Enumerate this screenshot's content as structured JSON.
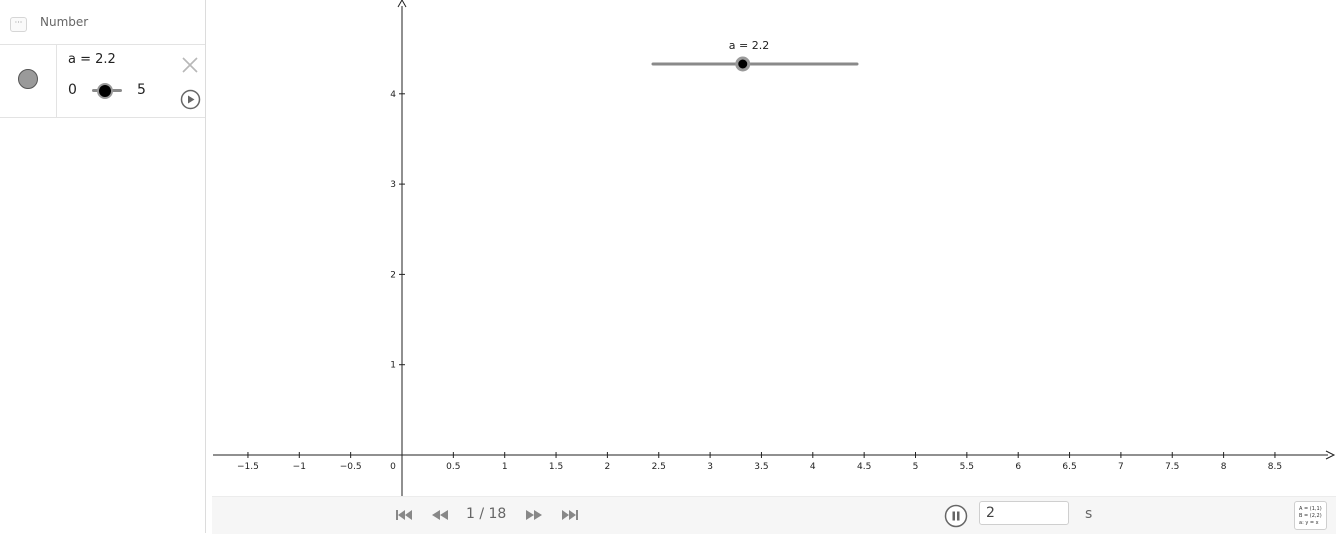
{
  "algebra": {
    "header_label": "Number",
    "collapse_label": "···",
    "item": {
      "definition": "a = 2.2",
      "slider_min": "0",
      "slider_max": "5",
      "marker_color": "#9a9a9a"
    }
  },
  "graphics": {
    "x_ticks": [
      "-1.5",
      "-1",
      "-0.5",
      "0",
      "0.5",
      "1",
      "1.5",
      "2",
      "2.5",
      "3",
      "3.5",
      "4",
      "4.5",
      "5",
      "5.5",
      "6",
      "6.5",
      "7",
      "7.5",
      "8",
      "8.5"
    ],
    "y_ticks": [
      "1",
      "2",
      "3",
      "4"
    ],
    "slider": {
      "caption": "a = 2.2",
      "value": 2.2,
      "min": 0,
      "max": 5
    }
  },
  "toolbar": {
    "step_indicator": "1 / 18",
    "speed_value": "2",
    "speed_unit": "s",
    "algebra_button_lines": [
      "A = (1,1)",
      "B = (2,2)",
      "a: y = x"
    ]
  },
  "colors": {
    "accent": "#000000",
    "track": "#8a8a8a",
    "icon": "#888888"
  }
}
